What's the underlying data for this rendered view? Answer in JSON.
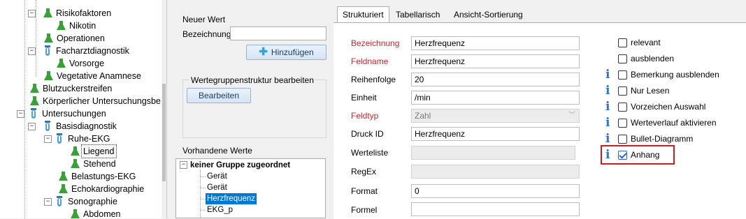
{
  "tree": {
    "items": [
      {
        "label": "Risikofaktoren",
        "icon": "flask-icon"
      },
      {
        "label": "Nikotin",
        "icon": "flask-icon"
      },
      {
        "label": "Operationen",
        "icon": "flask-icon"
      },
      {
        "label": "Facharztdiagnostik",
        "icon": "test-tube-icon"
      },
      {
        "label": "Vorsorge",
        "icon": "flask-icon"
      },
      {
        "label": "Vegetative Anamnese",
        "icon": "flask-icon"
      },
      {
        "label": "Blutzuckerstreifen",
        "icon": "flask-icon"
      },
      {
        "label": "Körperlicher Untersuchungsbe",
        "icon": "flask-icon"
      },
      {
        "label": "Untersuchungen",
        "icon": "test-tube-icon"
      },
      {
        "label": "Basisdiagnostik",
        "icon": "test-tube-icon"
      },
      {
        "label": "Ruhe-EKG",
        "icon": "test-tube-icon"
      },
      {
        "label": "Liegend",
        "icon": "flask-icon"
      },
      {
        "label": "Stehend",
        "icon": "flask-icon"
      },
      {
        "label": "Belastungs-EKG",
        "icon": "flask-icon"
      },
      {
        "label": "Echokardiographie",
        "icon": "flask-icon"
      },
      {
        "label": "Sonographie",
        "icon": "test-tube-icon"
      },
      {
        "label": "Abdomen",
        "icon": "flask-icon"
      }
    ]
  },
  "new_value": {
    "title": "Neuer Wert",
    "name_label": "Bezeichnung",
    "name_value": "",
    "add_button": "Hinzufügen"
  },
  "group_structure": {
    "title": "Wertegruppenstruktur bearbeiten",
    "edit_button": "Bearbeiten"
  },
  "existing_values": {
    "title": "Vorhandene Werte",
    "group": "keiner Gruppe zugeordnet",
    "items": [
      "Gerät",
      "Gerät",
      "Herzfrequenz",
      "EKG_p"
    ]
  },
  "tabs": [
    "Strukturiert",
    "Tabellarisch",
    "Ansicht-Sortierung"
  ],
  "form": {
    "bezeichnung": {
      "label": "Bezeichnung",
      "value": "Herzfrequenz"
    },
    "feldname": {
      "label": "Feldname",
      "value": "Herzfrequenz"
    },
    "reihenfolge": {
      "label": "Reihenfolge",
      "value": "20"
    },
    "einheit": {
      "label": "Einheit",
      "value": "/min"
    },
    "feldtyp": {
      "label": "Feldtyp",
      "value": "Zahl"
    },
    "druck_id": {
      "label": "Druck ID",
      "value": "Herzfrequenz"
    },
    "werteliste": {
      "label": "Werteliste",
      "value": ""
    },
    "regex": {
      "label": "RegEx",
      "value": ""
    },
    "format": {
      "label": "Format",
      "value": "0"
    },
    "formel": {
      "label": "Formel",
      "value": ""
    }
  },
  "options": [
    {
      "label": "relevant",
      "checked": false,
      "info": false
    },
    {
      "label": "ausblenden",
      "checked": false,
      "info": false
    },
    {
      "label": "Bemerkung ausblenden",
      "checked": false,
      "info": true
    },
    {
      "label": "Nur Lesen",
      "checked": false,
      "info": true
    },
    {
      "label": "Vorzeichen Auswahl",
      "checked": false,
      "info": true
    },
    {
      "label": "Werteverlauf aktivieren",
      "checked": false,
      "info": true
    },
    {
      "label": "Bullet-Diagramm",
      "checked": false,
      "info": true
    },
    {
      "label": "Anhang",
      "checked": true,
      "info": true
    }
  ],
  "colors": {
    "required_label": "#d4232b",
    "highlight_border": "#d8161e",
    "selection": "#0078d7",
    "info_icon": "#2a79c4"
  }
}
